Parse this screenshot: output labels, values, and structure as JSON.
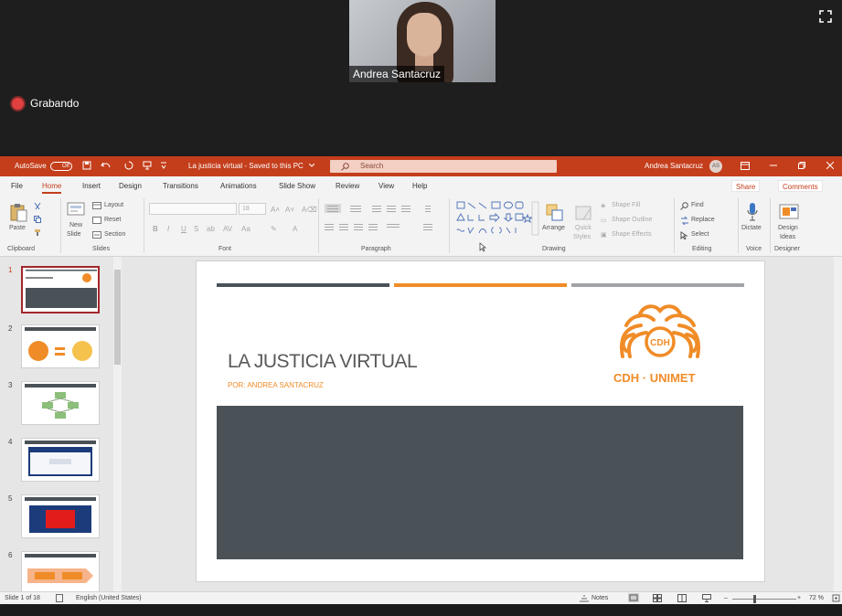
{
  "call": {
    "participant_name": "Andrea Santacruz",
    "recording_label": "Grabando",
    "rec_color": "#e04040"
  },
  "titlebar": {
    "autosave_label": "AutoSave",
    "autosave_state": "Off",
    "document_title": "La justicia virtual  -  Saved to this PC",
    "search_placeholder": "Search",
    "user_name": "Andrea Santacruz",
    "user_initials": "AS",
    "accent": "#c43e1c"
  },
  "menu": {
    "tabs": [
      "File",
      "Home",
      "Insert",
      "Design",
      "Transitions",
      "Animations",
      "Slide Show",
      "Review",
      "View",
      "Help"
    ],
    "active_tab": "Home",
    "share_label": "Share",
    "comments_label": "Comments"
  },
  "ribbon": {
    "clipboard": {
      "paste": "Paste",
      "label": "Clipboard"
    },
    "slides": {
      "new_slide_1": "New",
      "new_slide_2": "Slide",
      "layout": "Layout",
      "reset": "Reset",
      "section": "Section",
      "label": "Slides"
    },
    "font": {
      "size": "18",
      "label": "Font"
    },
    "paragraph": {
      "label": "Paragraph"
    },
    "drawing": {
      "arrange": "Arrange",
      "quick_styles_1": "Quick",
      "quick_styles_2": "Styles",
      "shape_fill": "Shape Fill",
      "shape_outline": "Shape Outline",
      "shape_effects": "Shape Effects",
      "label": "Drawing"
    },
    "editing": {
      "find": "Find",
      "replace": "Replace",
      "select": "Select",
      "label": "Editing"
    },
    "voice": {
      "dictate": "Dictate",
      "label": "Voice"
    },
    "designer": {
      "design_ideas_1": "Design",
      "design_ideas_2": "Ideas",
      "label": "Designer"
    }
  },
  "thumbnails": [
    {
      "number": "1",
      "selected": true
    },
    {
      "number": "2",
      "selected": false
    },
    {
      "number": "3",
      "selected": false
    },
    {
      "number": "4",
      "selected": false
    },
    {
      "number": "5",
      "selected": false
    },
    {
      "number": "6",
      "selected": false
    }
  ],
  "slide": {
    "title": "LA JUSTICIA VIRTUAL",
    "subtitle": "POR: ANDREA SANTACRUZ",
    "logo_initials": "CDH",
    "logo_text": "CDH · UNIMET",
    "logo_color": "#f08c28",
    "band_color": "#4a5157",
    "bar_colors": [
      "#4a5157",
      "#f08c28",
      "#a0a3a6"
    ]
  },
  "status": {
    "slide_info": "Slide 1 of 18",
    "language": "English (United States)",
    "notes_label": "Notes",
    "zoom": "72 %"
  }
}
